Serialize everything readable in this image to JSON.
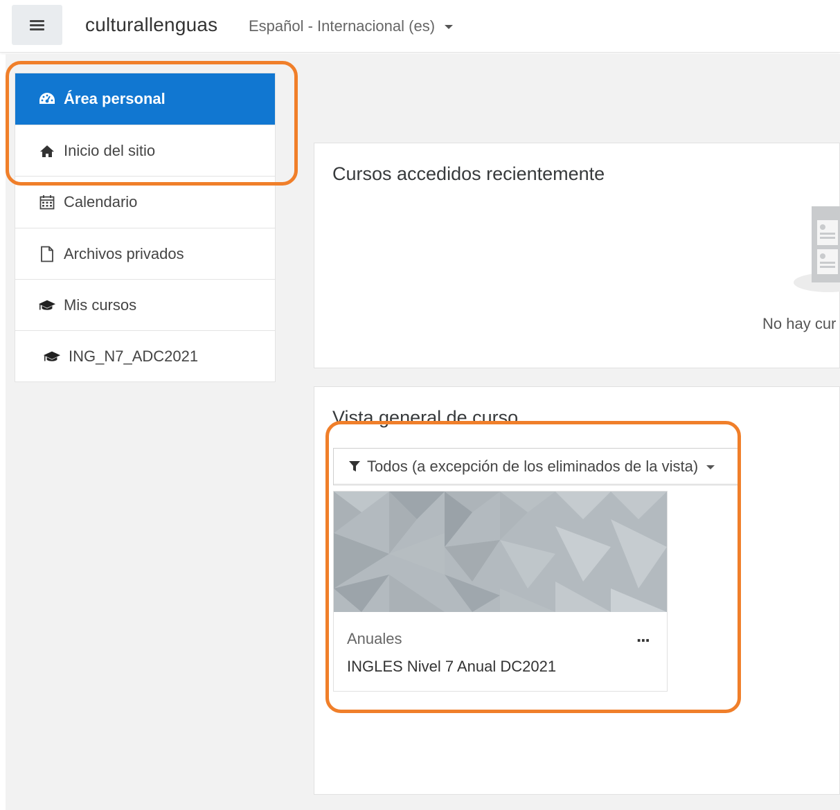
{
  "navbar": {
    "brand": "culturallenguas",
    "language": "Español ‎- Internacional ‎(es)‎"
  },
  "sidebar": {
    "items": [
      {
        "label": "Área personal",
        "icon": "dashboard-icon",
        "active": true
      },
      {
        "label": "Inicio del sitio",
        "icon": "home-icon"
      },
      {
        "label": "Calendario",
        "icon": "calendar-icon"
      },
      {
        "label": "Archivos privados",
        "icon": "file-icon"
      },
      {
        "label": "Mis cursos",
        "icon": "graduation-cap-icon"
      },
      {
        "label": "ING_N7_ADC2021",
        "icon": "graduation-cap-icon"
      }
    ]
  },
  "recent": {
    "title": "Cursos accedidos recientemente",
    "empty_text": "No hay cur"
  },
  "overview": {
    "title": "Vista general de curso",
    "filter_label": "Todos (a excepción de los eliminados de la vista)",
    "course": {
      "category": "Anuales",
      "name": "INGLES Nivel 7 Anual DC2021",
      "menu": "..."
    }
  },
  "colors": {
    "active": "#1177d1",
    "highlight": "#f07f2a",
    "background": "#f2f2f2"
  }
}
